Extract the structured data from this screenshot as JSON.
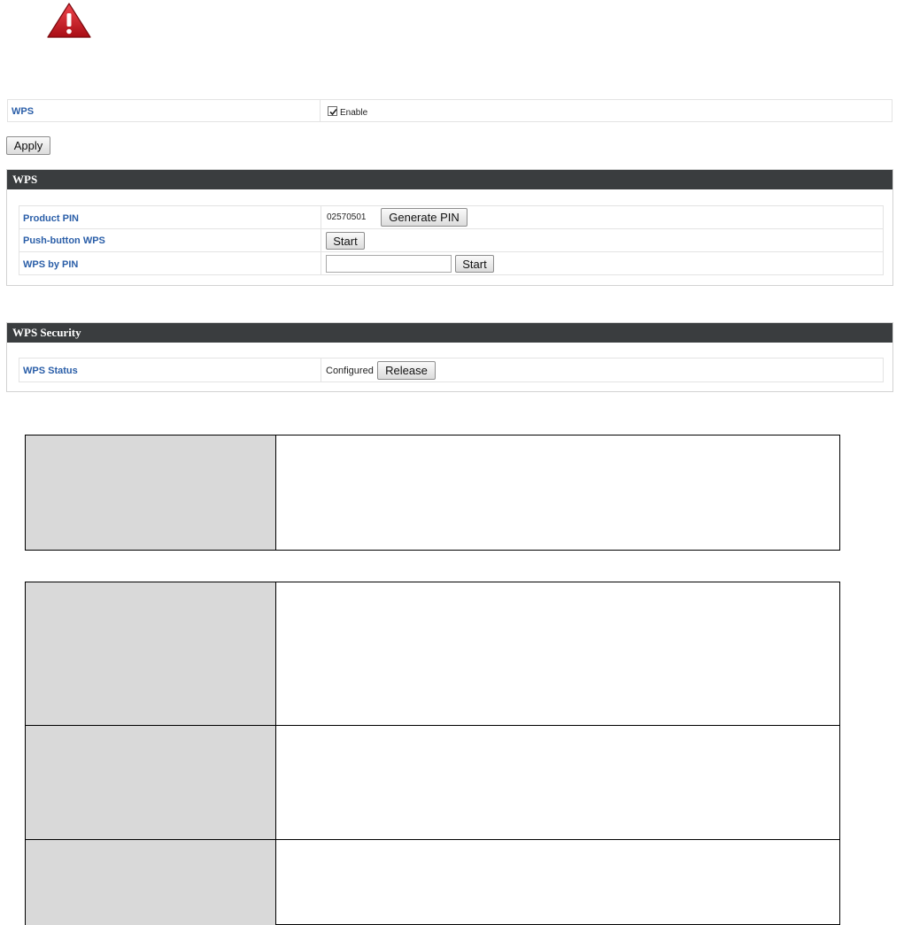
{
  "warning": {
    "icon": "warning-triangle-icon",
    "color": "#c8141e"
  },
  "wps_enable": {
    "label": "WPS",
    "checkbox_label": "Enable",
    "checked": true
  },
  "apply_label": "Apply",
  "wps_panel": {
    "title": "WPS",
    "rows": [
      {
        "label": "Product PIN",
        "value": "02570501",
        "button": "Generate PIN"
      },
      {
        "label": "Push-button WPS",
        "button": "Start"
      },
      {
        "label": "WPS by PIN",
        "input_value": "",
        "button": "Start"
      }
    ]
  },
  "security_panel": {
    "title": "WPS Security",
    "rows": [
      {
        "label": "WPS Status",
        "value": "Configured",
        "button": "Release"
      }
    ]
  },
  "colors": {
    "header_bg": "#3a3d3f",
    "label_blue": "#2a5ea8",
    "desc_left_bg": "#d9d9d9"
  }
}
